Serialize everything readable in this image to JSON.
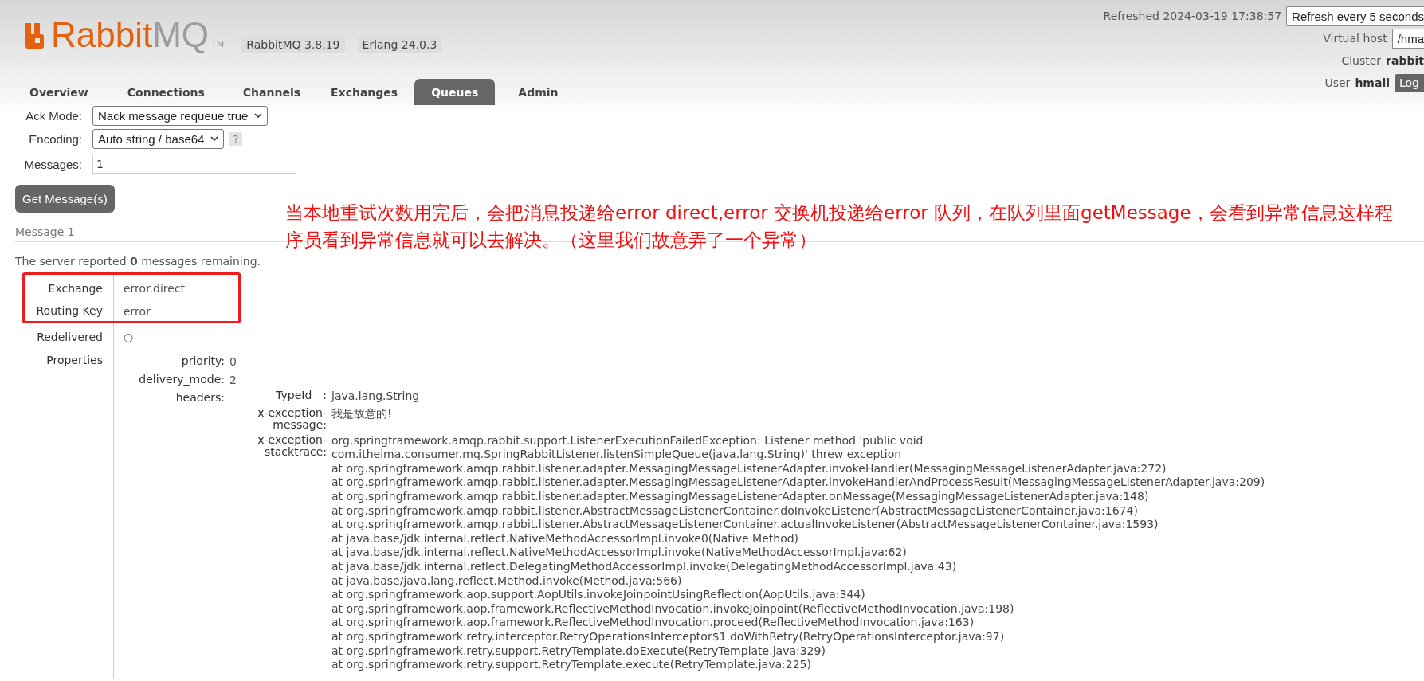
{
  "logo": {
    "name": "Rabbit",
    "suffix": "MQ",
    "tm": "TM"
  },
  "versions": [
    "RabbitMQ 3.8.19",
    "Erlang 24.0.3"
  ],
  "tabs": [
    {
      "label": "Overview",
      "selected": false
    },
    {
      "label": "Connections",
      "selected": false
    },
    {
      "label": "Channels",
      "selected": false
    },
    {
      "label": "Exchanges",
      "selected": false
    },
    {
      "label": "Queues",
      "selected": true
    },
    {
      "label": "Admin",
      "selected": false
    }
  ],
  "refreshed": "Refreshed 2024-03-19 17:38:57",
  "refresh_select": "Refresh every 5 seconds",
  "virtual_host": {
    "label": "Virtual host",
    "value": "/hma"
  },
  "cluster": {
    "label": "Cluster",
    "value": "rabbit"
  },
  "user": {
    "label": "User",
    "value": "hmall",
    "button": "Log"
  },
  "form": {
    "ack_mode": {
      "label": "Ack Mode:",
      "value": "Nack message requeue true"
    },
    "encoding": {
      "label": "Encoding:",
      "value": "Auto string / base64",
      "help": "?"
    },
    "messages": {
      "label": "Messages:",
      "value": "1"
    },
    "button": "Get Message(s)"
  },
  "message_title": "Message 1",
  "annotation": "当本地重试次数用完后，会把消息投递给error direct,error 交换机投递给error 队列，在队列里面getMessage，会看到异常信息这样程序员看到异常信息就可以去解决。（这里我们故意弄了一个异常）",
  "remaining": "The server reported **0** messages remaining.",
  "details": [
    {
      "label": "Exchange",
      "value": "error.direct"
    },
    {
      "label": "Routing Key",
      "value": "error"
    },
    {
      "label": "Redelivered",
      "value": "○"
    }
  ],
  "properties": {
    "label": "Properties",
    "items": [
      {
        "key": "priority:",
        "value": "0"
      },
      {
        "key": "delivery_mode:",
        "value": "2"
      }
    ],
    "headers_key": "headers:",
    "headers": [
      {
        "key": "__TypeId__:",
        "lines": [
          "java.lang.String"
        ]
      },
      {
        "key": "x-exception-message:",
        "lines": [
          "我是故意的!"
        ]
      },
      {
        "key": "x-exception-stacktrace:",
        "lines": [
          "org.springframework.amqp.rabbit.support.ListenerExecutionFailedException: Listener method 'public void",
          "com.itheima.consumer.mq.SpringRabbitListener.listenSimpleQueue(java.lang.String)' threw exception",
          "at org.springframework.amqp.rabbit.listener.adapter.MessagingMessageListenerAdapter.invokeHandler(MessagingMessageListenerAdapter.java:272)",
          "at org.springframework.amqp.rabbit.listener.adapter.MessagingMessageListenerAdapter.invokeHandlerAndProcessResult(MessagingMessageListenerAdapter.java:209)",
          "at org.springframework.amqp.rabbit.listener.adapter.MessagingMessageListenerAdapter.onMessage(MessagingMessageListenerAdapter.java:148)",
          "at org.springframework.amqp.rabbit.listener.AbstractMessageListenerContainer.doInvokeListener(AbstractMessageListenerContainer.java:1674)",
          "at org.springframework.amqp.rabbit.listener.AbstractMessageListenerContainer.actualInvokeListener(AbstractMessageListenerContainer.java:1593)",
          "at java.base/jdk.internal.reflect.NativeMethodAccessorImpl.invoke0(Native Method)",
          "at java.base/jdk.internal.reflect.NativeMethodAccessorImpl.invoke(NativeMethodAccessorImpl.java:62)",
          "at java.base/jdk.internal.reflect.DelegatingMethodAccessorImpl.invoke(DelegatingMethodAccessorImpl.java:43)",
          "at java.base/java.lang.reflect.Method.invoke(Method.java:566)",
          "at org.springframework.aop.support.AopUtils.invokeJoinpointUsingReflection(AopUtils.java:344)",
          "at org.springframework.aop.framework.ReflectiveMethodInvocation.invokeJoinpoint(ReflectiveMethodInvocation.java:198)",
          "at org.springframework.aop.framework.ReflectiveMethodInvocation.proceed(ReflectiveMethodInvocation.java:163)",
          "at org.springframework.retry.interceptor.RetryOperationsInterceptor$1.doWithRetry(RetryOperationsInterceptor.java:97)",
          "at org.springframework.retry.support.RetryTemplate.doExecute(RetryTemplate.java:329)",
          "at org.springframework.retry.support.RetryTemplate.execute(RetryTemplate.java:225)"
        ]
      }
    ]
  }
}
